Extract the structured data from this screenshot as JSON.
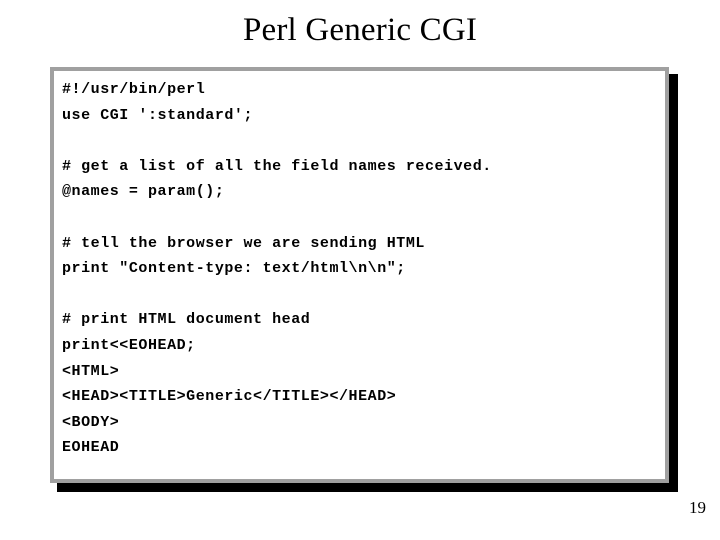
{
  "slide": {
    "title": "Perl Generic CGI",
    "number": "19",
    "colors": {
      "background": "#ffffff",
      "text": "#000000",
      "box_border": "#a0a0a0",
      "box_shadow": "#000000",
      "box_fill": "#ffffff"
    }
  },
  "code_block": {
    "language": "perl",
    "lines": [
      "#!/usr/bin/perl",
      "use CGI ':standard';",
      "",
      "# get a list of all the field names received.",
      "@names = param();",
      "",
      "# tell the browser we are sending HTML",
      "print \"Content-type: text/html\\n\\n\";",
      "",
      "# print HTML document head",
      "print<<EOHEAD;",
      "<HTML>",
      "<HEAD><TITLE>Generic</TITLE></HEAD>",
      "<BODY>",
      "EOHEAD"
    ]
  }
}
